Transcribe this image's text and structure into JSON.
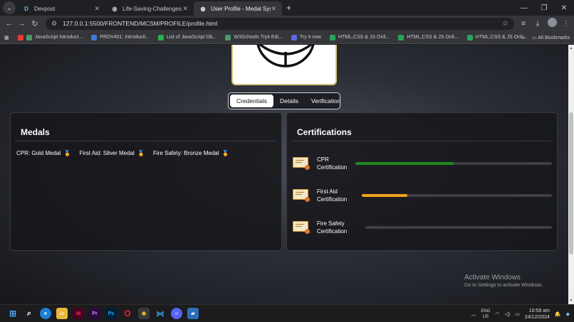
{
  "browser": {
    "tabs": [
      {
        "title": "Devpost",
        "favicon": "D",
        "active": false
      },
      {
        "title": "Life-Saving-Challenges.pdf",
        "favicon": "globe",
        "active": false
      },
      {
        "title": "User Profile - Medal System",
        "favicon": "globe",
        "active": true
      }
    ],
    "url": "127.0.0.1:5500/FRONTEND/MCSM/PROFILE/profile.html",
    "bookmarks": [
      "JavaScript Introduct...",
      "PRDV401: Introducti...",
      "List of JavaScript Ob...",
      "W3Schools Tryit Edi...",
      "Try it now",
      "HTML,CSS & JS Onli...",
      "HTML,CSS & JS Onli...",
      "HTML,CSS & JS Onli..."
    ],
    "all_bookmarks": "All Bookmarks"
  },
  "page": {
    "tabs": [
      "Credentials",
      "Details",
      "Verification"
    ],
    "active_tab": "Credentials",
    "medals": {
      "title": "Medals",
      "items": [
        "CPR: Gold Medal",
        "First Aid: Silver Medal",
        "Fire Safety: Bronze Medal"
      ]
    },
    "certifications": {
      "title": "Certifications",
      "items": [
        {
          "name_line1": "CPR",
          "name_line2": "Certification",
          "progress": 0.5,
          "color": "#1f8a1f"
        },
        {
          "name_line1": "First Aid",
          "name_line2": "Certification",
          "progress": 0.24,
          "color": "#f0a31a"
        },
        {
          "name_line1": "Fire Safety",
          "name_line2": "Certification",
          "progress": 0.0,
          "color": "#3e3e44"
        }
      ]
    }
  },
  "watermark": {
    "line1": "Activate Windows",
    "line2": "Go to Settings to activate Windows."
  },
  "taskbar": {
    "lang_line1": "ENG",
    "lang_line2": "US",
    "time": "10:58 am",
    "date": "24/12/2024"
  }
}
